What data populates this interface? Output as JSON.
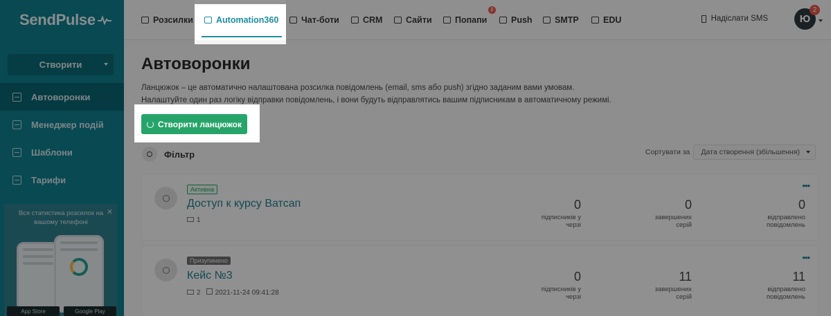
{
  "brand": {
    "name": "SendPulse"
  },
  "sidebar": {
    "create_label": "Створити",
    "items": [
      {
        "label": "Автоворонки",
        "active": true,
        "icon": "funnel-icon"
      },
      {
        "label": "Менеджер подій",
        "active": false,
        "icon": "events-icon"
      },
      {
        "label": "Шаблони",
        "active": false,
        "icon": "templates-icon"
      },
      {
        "label": "Тарифи",
        "active": false,
        "icon": "pricing-icon"
      }
    ],
    "promo": {
      "text": "Вся статистика розсилок на вашому телефоні",
      "app_store": "App Store",
      "google_play": "Google Play"
    }
  },
  "topnav": {
    "tabs": [
      {
        "label": "Розсилки",
        "icon": "mail-icon"
      },
      {
        "label": "Automation360",
        "icon": "automation-icon",
        "active": true
      },
      {
        "label": "Чат-боти",
        "icon": "chat-icon"
      },
      {
        "label": "CRM",
        "icon": "crm-icon"
      },
      {
        "label": "Сайти",
        "icon": "site-icon"
      },
      {
        "label": "Попапи",
        "icon": "popup-icon",
        "badge": "β"
      },
      {
        "label": "Push",
        "icon": "bell-icon"
      },
      {
        "label": "SMTP",
        "icon": "code-icon"
      },
      {
        "label": "EDU",
        "icon": "graduation-icon"
      }
    ],
    "sms_label": "Надіслати SMS",
    "avatar_initial": "Ю",
    "avatar_badge": "2"
  },
  "main": {
    "title": "Автоворонки",
    "description_line1": "Ланцюжок – це автоматично налаштована розсилка повідомлень (email, sms або push) згідно заданим вами умовам.",
    "description_line2": "Налаштуйте один раз логіку відправки повідомлень, і вони будуть відправлятись вашим підписникам в автоматичному режимі.",
    "create_chain_label": "Створити ланцюжок",
    "filter_label": "Фільтр",
    "sort_label": "Сортувати за",
    "sort_value": "Дата створення (збільшення)"
  },
  "flows": [
    {
      "status": "Активна",
      "title": "Доступ к курсу Ватсап",
      "messages": "1",
      "date": "",
      "queue": "0",
      "queue_label": "підписників у черзі",
      "completed": "0",
      "completed_label": "завершених серій",
      "sent": "0",
      "sent_label": "відправлено повідомлень"
    },
    {
      "status": "Призупинено",
      "title": "Кейс №3",
      "messages": "2",
      "date": "2021-11-24 09:41:28",
      "queue": "0",
      "queue_label": "підписників у черзі",
      "completed": "11",
      "completed_label": "завершених серій",
      "sent": "11",
      "sent_label": "відправлено повідомлень"
    }
  ],
  "colors": {
    "sidebar": "#0f7f8d",
    "accent": "#1d8fa0",
    "cta": "#26a46a"
  }
}
